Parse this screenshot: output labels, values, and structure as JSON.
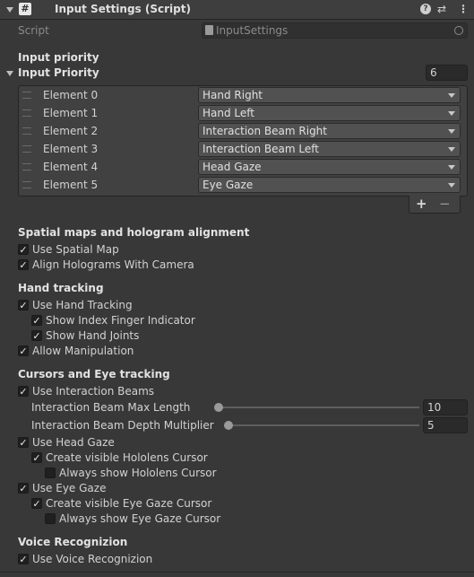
{
  "header": {
    "title": "Input Settings (Script)",
    "icons": [
      "script-hash-icon",
      "help-icon",
      "presets-icon",
      "more-menu-icon"
    ]
  },
  "script_field": {
    "label": "Script",
    "value": "InputSettings"
  },
  "input_priority_section": "Input priority",
  "input_priority_list": {
    "label": "Input Priority",
    "size": "6",
    "elements": [
      {
        "label": "Element 0",
        "value": "Hand Right"
      },
      {
        "label": "Element 1",
        "value": "Hand Left"
      },
      {
        "label": "Element 2",
        "value": "Interaction Beam Right"
      },
      {
        "label": "Element 3",
        "value": "Interaction Beam Left"
      },
      {
        "label": "Element 4",
        "value": "Head Gaze"
      },
      {
        "label": "Element 5",
        "value": "Eye Gaze"
      }
    ],
    "add_label": "+",
    "remove_label": "−"
  },
  "spatial": {
    "title": "Spatial maps and hologram alignment",
    "use_spatial_map": {
      "label": "Use Spatial Map",
      "checked": true
    },
    "align_holograms": {
      "label": "Align Holograms With Camera",
      "checked": true
    }
  },
  "hand_tracking": {
    "title": "Hand tracking",
    "use_hand_tracking": {
      "label": "Use Hand Tracking",
      "checked": true
    },
    "show_index_finger": {
      "label": "Show Index Finger Indicator",
      "checked": true
    },
    "show_hand_joints": {
      "label": "Show Hand Joints",
      "checked": true
    },
    "allow_manipulation": {
      "label": "Allow Manipulation",
      "checked": true
    }
  },
  "cursors": {
    "title": "Cursors and Eye tracking",
    "use_interaction_beams": {
      "label": "Use Interaction Beams",
      "checked": true
    },
    "beam_max_length": {
      "label": "Interaction Beam Max Length",
      "value": "10",
      "fraction": 0.0
    },
    "beam_depth_multiplier": {
      "label": "Interaction Beam Depth Multiplier",
      "value": "5",
      "fraction": 0.05
    },
    "use_head_gaze": {
      "label": "Use Head Gaze",
      "checked": true
    },
    "create_hololens_cursor": {
      "label": "Create visible Hololens Cursor",
      "checked": true
    },
    "always_hololens_cursor": {
      "label": "Always show Hololens Cursor",
      "checked": false
    },
    "use_eye_gaze": {
      "label": "Use Eye Gaze",
      "checked": true
    },
    "create_eye_gaze_cursor": {
      "label": "Create visible Eye Gaze Cursor",
      "checked": true
    },
    "always_eye_gaze_cursor": {
      "label": "Always show Eye Gaze Cursor",
      "checked": false
    }
  },
  "voice": {
    "title": "Voice Recognizion",
    "use_voice": {
      "label": "Use Voice Recognizion",
      "checked": true
    }
  },
  "glyphs": {
    "check": "✓"
  }
}
